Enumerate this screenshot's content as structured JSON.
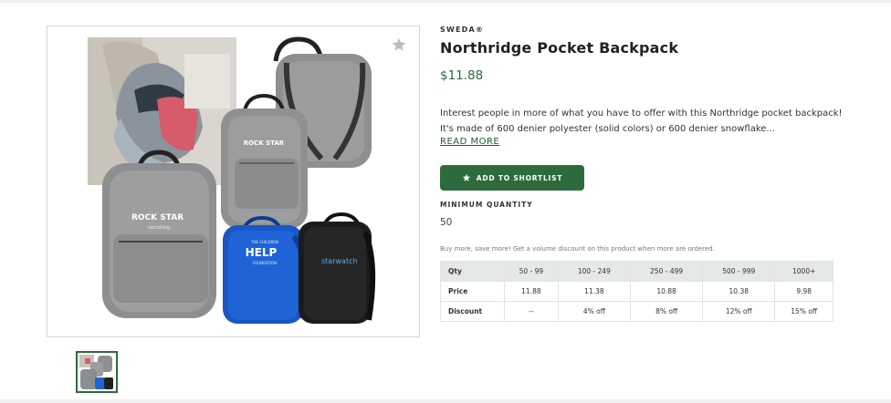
{
  "product": {
    "brand": "SWEDA®",
    "title": "Northridge Pocket Backpack",
    "price": "$11.88",
    "description": "Interest people in more of what you have to offer with this Northridge pocket backpack! It's made of 600 denier polyester (solid colors) or 600 denier snowflake...",
    "read_more": "READ MORE",
    "images": {
      "logo_rockstar": "ROCK STAR",
      "logo_rockstar_sub": "recruiting",
      "logo_help": "HELP",
      "logo_help_top": "THE CHILDREN",
      "logo_help_bottom": "FOUNDATION",
      "logo_watch": "starwatch"
    }
  },
  "actions": {
    "shortlist_label": "ADD TO SHORTLIST"
  },
  "quantity": {
    "label": "MINIMUM QUANTITY",
    "value": "50"
  },
  "pricing": {
    "note": "Buy more, save more! Get a volume discount on this product when more are ordered.",
    "headers": [
      "Qty",
      "50 - 99",
      "100 - 249",
      "250 - 499",
      "500 - 999",
      "1000+"
    ],
    "price_row": [
      "Price",
      "11.88",
      "11.38",
      "10.88",
      "10.38",
      "9.98"
    ],
    "discount_row": [
      "Discount",
      "--",
      "4% off",
      "8% off",
      "12% off",
      "15% off"
    ]
  },
  "colors": {
    "accent": "#2d6a3c",
    "table_header": "#e4e8e6"
  },
  "icons": {
    "favorite": "star-outline-icon",
    "shortlist": "star-icon"
  }
}
